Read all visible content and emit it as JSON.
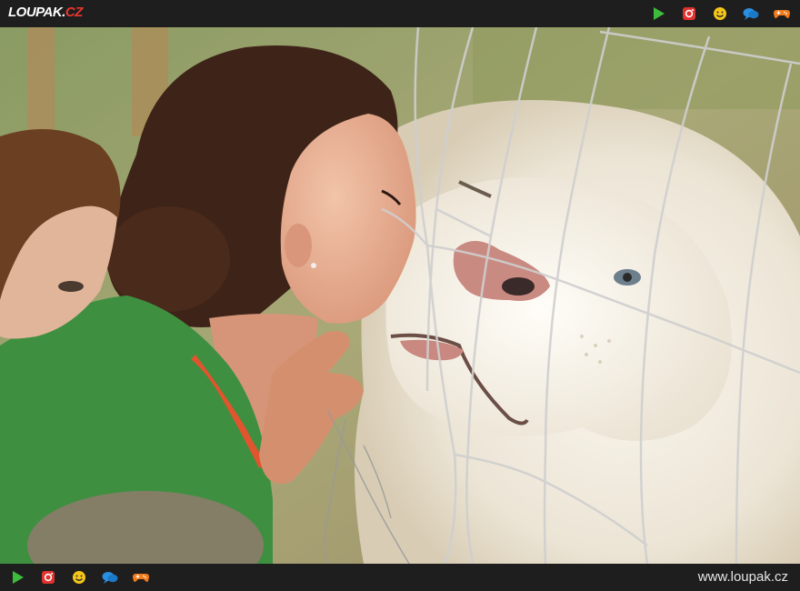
{
  "header": {
    "logo_main": "LOUPAK.",
    "logo_tld": "CZ"
  },
  "footer": {
    "site_url": "www.loupak.cz"
  },
  "icons": [
    "play-icon",
    "instagram-icon",
    "smiley-icon",
    "chat-icon",
    "gamepad-icon"
  ],
  "colors": {
    "bar_bg": "#1e1e1e",
    "play": "#3dbb3d",
    "instagram": "#e0322e",
    "smiley": "#f5c518",
    "chat": "#2a8fe0",
    "gamepad": "#f07a1a"
  },
  "photo": {
    "subject": "woman kissing white lion through fence"
  }
}
